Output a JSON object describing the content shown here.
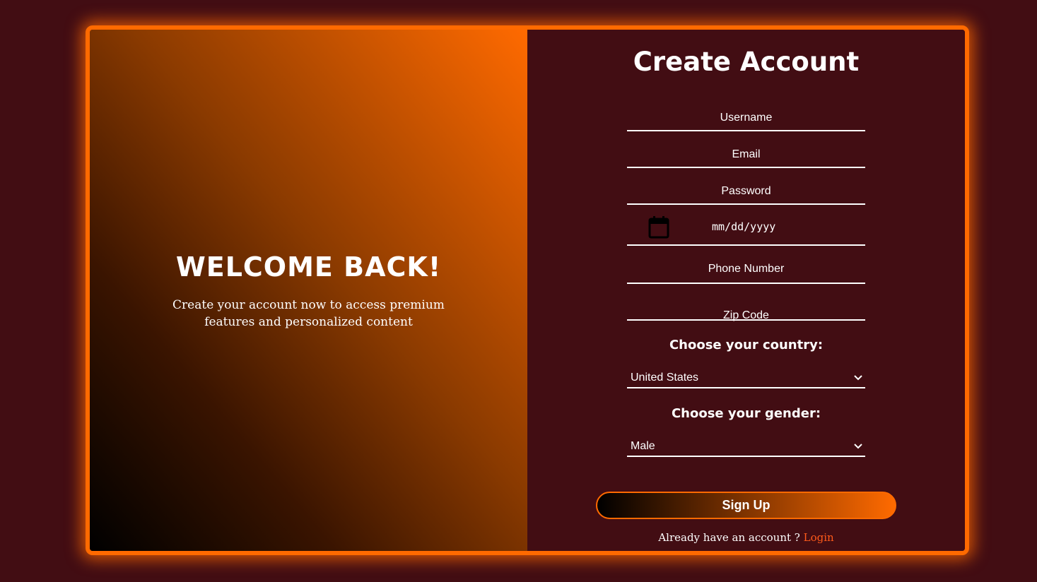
{
  "left_panel": {
    "title": "WELCOME BACK!",
    "subtitle": "Create your account now to access premium features and personalized content"
  },
  "form": {
    "title": "Create Account",
    "username_placeholder": "Username",
    "email_placeholder": "Email",
    "password_placeholder": "Password",
    "date_placeholder": "mm/dd/yyyy",
    "phone_placeholder": "Phone Number",
    "zip_placeholder": "Zip Code",
    "country_label": "Choose your country:",
    "country_value": "United States",
    "gender_label": "Choose your gender:",
    "gender_value": "Male",
    "signup_label": "Sign Up",
    "already_text": "Already have an account ?",
    "login_label": "Login"
  },
  "colors": {
    "background": "#420d13",
    "accent": "#ff6a00",
    "link": "#ff5a1a"
  },
  "icons": {
    "date": "calendar-icon",
    "select": "chevron-down-icon"
  }
}
